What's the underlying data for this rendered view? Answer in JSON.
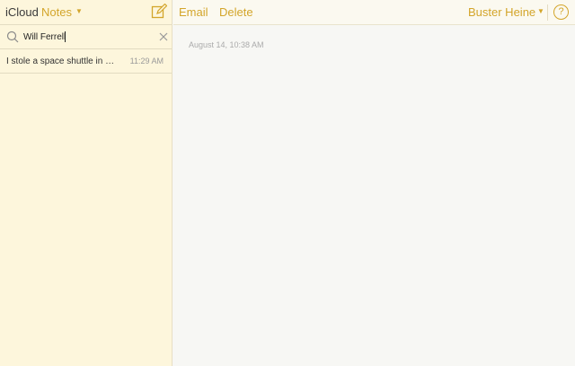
{
  "header": {
    "app_name": "iCloud",
    "section": "Notes"
  },
  "search": {
    "value": "Will Ferrell"
  },
  "notes": [
    {
      "title": "I stole a space shuttle in …",
      "time": "11:29 AM"
    }
  ],
  "toolbar": {
    "email_label": "Email",
    "delete_label": "Delete",
    "user_name": "Buster Heine",
    "help_label": "?"
  },
  "note": {
    "date": "August 14, 10:38 AM"
  },
  "colors": {
    "accent": "#d3a52a",
    "sidebar_bg": "#fdf6dc",
    "paper_bg": "#f7f7f4"
  }
}
